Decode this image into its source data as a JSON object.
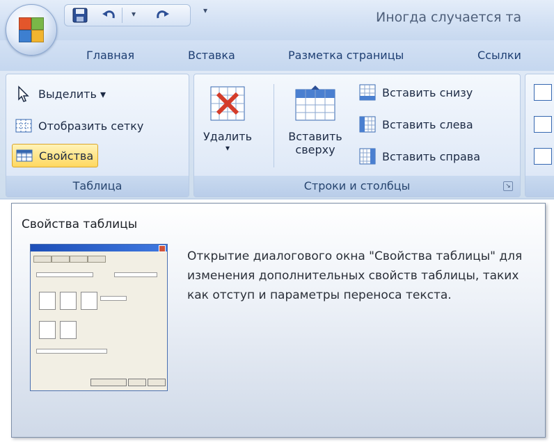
{
  "title_bar": {
    "document_title": "Иногда случается та",
    "quick_access": [
      {
        "name": "save-icon"
      },
      {
        "name": "undo-icon"
      },
      {
        "name": "redo-icon"
      },
      {
        "name": "customize-arrow-icon"
      }
    ]
  },
  "tabs": [
    "Главная",
    "Вставка",
    "Разметка страницы",
    "Ссылки"
  ],
  "ribbon": {
    "table_group": {
      "label": "Таблица",
      "select_label": "Выделить ▾",
      "gridlines_label": "Отобразить сетку",
      "properties_label": "Свойства"
    },
    "rows_cols_group": {
      "label": "Строки и столбцы",
      "delete_label_line1": "Удалить",
      "delete_label_line2": "▾",
      "insert_above_line1": "Вставить",
      "insert_above_line2": "сверху",
      "insert_below_label": "Вставить снизу",
      "insert_left_label": "Вставить слева",
      "insert_right_label": "Вставить справа"
    }
  },
  "tooltip": {
    "title": "Свойства таблицы",
    "description": "Открытие диалогового окна \"Свойства таблицы\" для изменения дополнительных свойств таблицы, таких как отступ и параметры переноса текста."
  },
  "colors": {
    "ribbon_text": "#1c2a44",
    "tab_text": "#1e3f73",
    "highlight": "#ffd860",
    "delete_red": "#d43c2a"
  }
}
